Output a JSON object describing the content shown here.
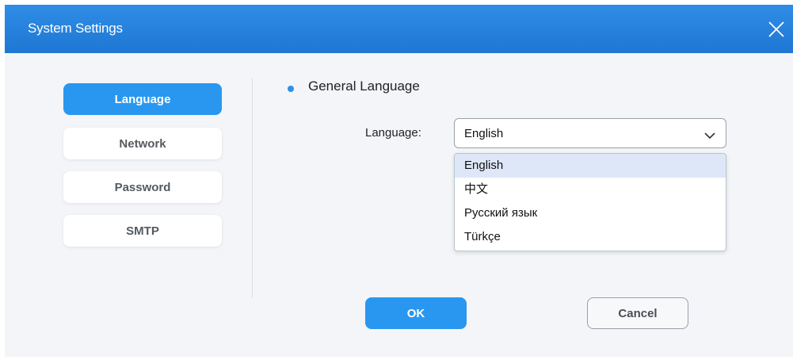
{
  "dialog": {
    "title": "System Settings",
    "close_icon": "close-icon"
  },
  "sidebar": {
    "items": [
      {
        "label": "Language",
        "active": true
      },
      {
        "label": "Network",
        "active": false
      },
      {
        "label": "Password",
        "active": false
      },
      {
        "label": "SMTP",
        "active": false
      }
    ]
  },
  "section": {
    "title": "General Language",
    "bullet_icon": "bullet-dot-icon"
  },
  "language_field": {
    "label": "Language:",
    "selected": "English",
    "chevron_icon": "chevron-down-icon",
    "options": [
      "English",
      "中文",
      "Русский язык",
      "Türkçe"
    ],
    "highlighted_option": "English"
  },
  "actions": {
    "ok_label": "OK",
    "cancel_label": "Cancel"
  },
  "colors": {
    "accent": "#2997f0",
    "titlebar": "#1e77d3",
    "background": "#f3f5f8"
  }
}
